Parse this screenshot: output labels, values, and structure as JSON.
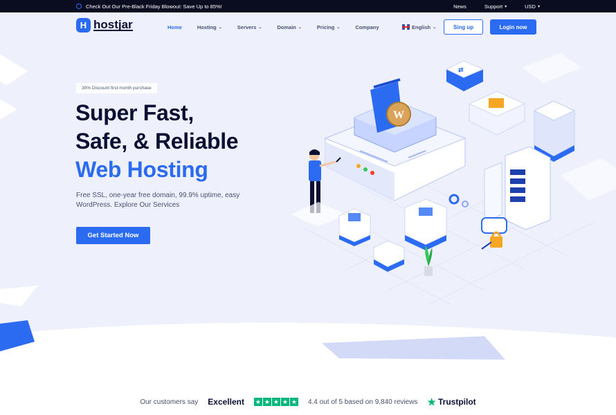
{
  "topbar": {
    "promo": "Check Out Our Pre-Black Friday Blowout: Save Up to 85%!",
    "news": "News",
    "support": "Support",
    "currency": "USD"
  },
  "nav": {
    "logo_letter": "H",
    "logo_text": "hostjar",
    "items": [
      {
        "label": "Home",
        "dropdown": false
      },
      {
        "label": "Hosting",
        "dropdown": true
      },
      {
        "label": "Servers",
        "dropdown": true
      },
      {
        "label": "Domain",
        "dropdown": true
      },
      {
        "label": "Pricing",
        "dropdown": true
      },
      {
        "label": "Company",
        "dropdown": false
      }
    ],
    "language": "English",
    "signup": "Sing up",
    "login": "Login now"
  },
  "hero": {
    "badge": "30% Discount first month purchase",
    "title_line1": "Super Fast,",
    "title_line2": "Safe, & Reliable",
    "title_line3": "Web Hosting",
    "description": "Free SSL, one-year free domain, 99.9% uptime, easy WordPress. Explore Our Services",
    "cta": "Get Started Now"
  },
  "reviews": {
    "lead": "Our customers say",
    "rating_word": "Excellent",
    "stars": 5,
    "summary": "4.4 out of 5 based on 9,840 reviews",
    "brand": "Trustpilot"
  },
  "colors": {
    "accent": "#2a6bf2",
    "dark": "#0b1033",
    "hero_bg": "#eef1fb",
    "trustpilot": "#00b67a"
  }
}
